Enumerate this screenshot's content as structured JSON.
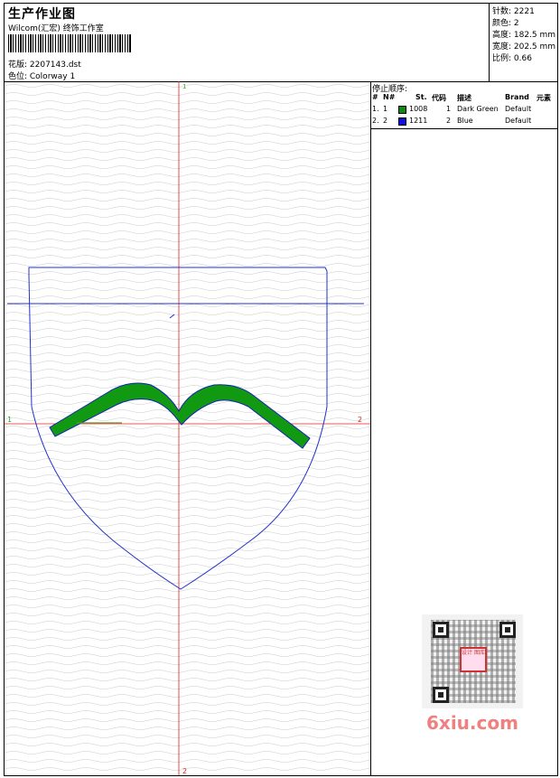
{
  "header": {
    "title": "生产作业图",
    "subtitle": "Wilcom(汇宏) 终饰工作室",
    "design_label": "花版: 2207143.dst",
    "colorway_label": "色位: Colorway 1"
  },
  "stats": {
    "stitches": "针数: 2221",
    "colors": "颜色: 2",
    "height": "高度: 182.5 mm",
    "width": "宽度: 202.5 mm",
    "scale": "比例: 0.66"
  },
  "canvas": {
    "axis_top": "1",
    "axis_bottom": "2",
    "axis_left": "1",
    "axis_right": "2"
  },
  "stop_sequence": {
    "title": "停止顺序:",
    "headers": [
      "#",
      "N#",
      "St.",
      "代码",
      "描述",
      "Brand",
      "元素"
    ],
    "rows": [
      {
        "num": "1.",
        "n": "1",
        "color": "#118811",
        "st": "1008",
        "code": "1",
        "desc": "Dark Green",
        "brand": "Default"
      },
      {
        "num": "2.",
        "n": "2",
        "color": "#1111dd",
        "st": "1211",
        "code": "2",
        "desc": "Blue",
        "brand": "Default"
      }
    ]
  },
  "watermark": {
    "text": "6xiu.com",
    "qr_badge": "设计 图库"
  },
  "colors": {
    "outline": "#2233cc",
    "fill": "#119911",
    "crosshair": "#e02020"
  }
}
